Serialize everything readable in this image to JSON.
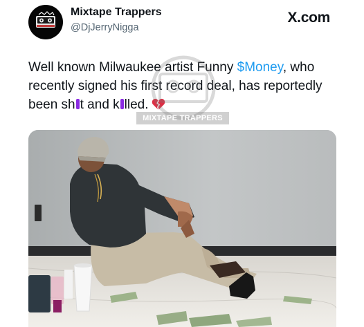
{
  "post": {
    "author": {
      "name": "Mixtape Trappers",
      "handle": "@DjJerryNigga",
      "avatar_logo_text": "MIXTAPE TRAPPERS"
    },
    "brand": "X.com",
    "text": {
      "part1": "Well known Milwaukee artist Funny ",
      "cashtag": "$Money",
      "part2": ", who recently signed his first record deal, has reportedly been sh",
      "part3": "t and k",
      "part4": "lled."
    },
    "emoji_icon": "broken-heart-icon",
    "watermark_text": "MIXTAPE TRAPPERS",
    "colors": {
      "cashtag": "#1d9bf0",
      "censor_bar": "#8a2be2",
      "handle": "#536471",
      "text": "#0f1419"
    }
  }
}
